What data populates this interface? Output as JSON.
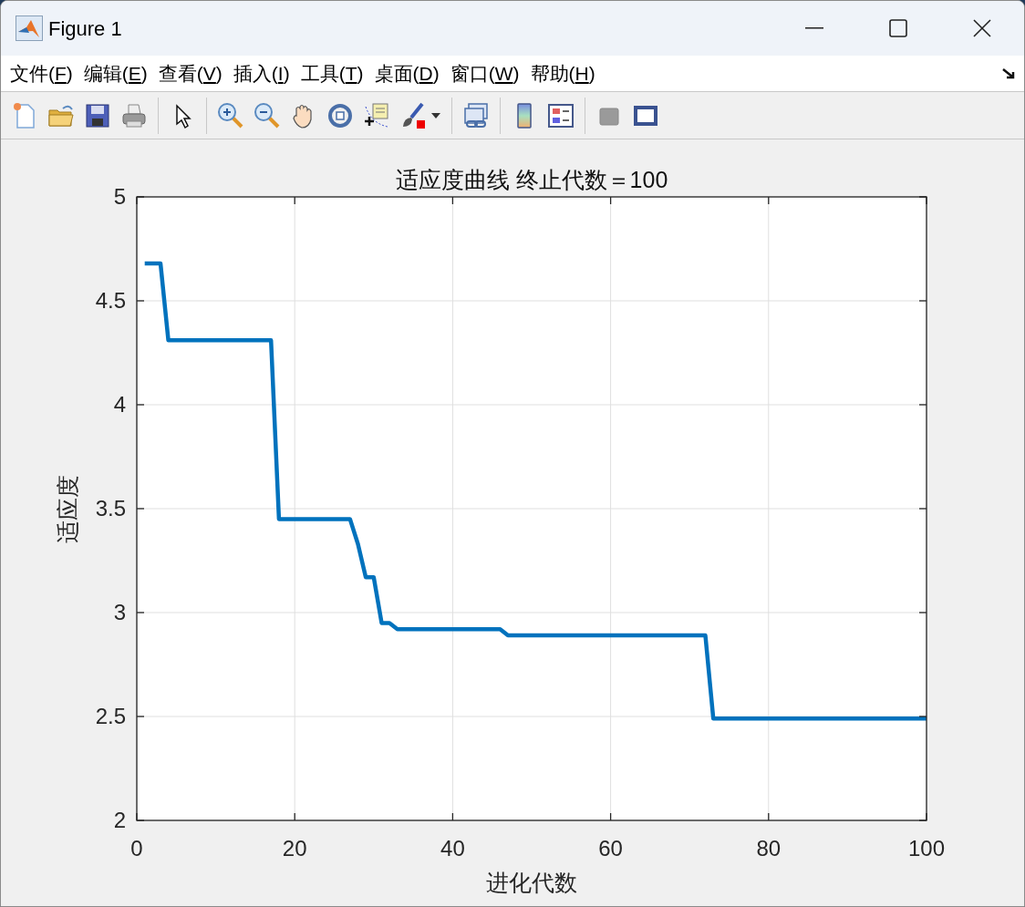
{
  "window": {
    "title": "Figure 1"
  },
  "menu": [
    {
      "label": "文件(F)"
    },
    {
      "label": "编辑(E)"
    },
    {
      "label": "查看(V)"
    },
    {
      "label": "插入(I)"
    },
    {
      "label": "工具(T)"
    },
    {
      "label": "桌面(D)"
    },
    {
      "label": "窗口(W)"
    },
    {
      "label": "帮助(H)"
    }
  ],
  "figure": {
    "chart_data": {
      "type": "line",
      "title": "适应度曲线 终止代数＝100",
      "xlabel": "进化代数",
      "ylabel": "适应度",
      "x": [
        1,
        2,
        3,
        4,
        5,
        6,
        7,
        8,
        9,
        10,
        11,
        12,
        13,
        14,
        15,
        16,
        17,
        18,
        19,
        20,
        21,
        22,
        23,
        24,
        25,
        26,
        27,
        28,
        29,
        30,
        31,
        32,
        33,
        34,
        35,
        36,
        37,
        38,
        39,
        40,
        41,
        42,
        43,
        44,
        45,
        46,
        47,
        48,
        49,
        50,
        51,
        52,
        53,
        54,
        55,
        56,
        57,
        58,
        59,
        60,
        61,
        62,
        63,
        64,
        65,
        66,
        67,
        68,
        69,
        70,
        71,
        72,
        73,
        74,
        75,
        76,
        77,
        78,
        79,
        80,
        81,
        82,
        83,
        84,
        85,
        86,
        87,
        88,
        89,
        90,
        91,
        92,
        93,
        94,
        95,
        96,
        97,
        98,
        99,
        100
      ],
      "series": [
        {
          "color": "#0072bd",
          "values": [
            4.68,
            4.68,
            4.68,
            4.31,
            4.31,
            4.31,
            4.31,
            4.31,
            4.31,
            4.31,
            4.31,
            4.31,
            4.31,
            4.31,
            4.31,
            4.31,
            4.31,
            3.45,
            3.45,
            3.45,
            3.45,
            3.45,
            3.45,
            3.45,
            3.45,
            3.45,
            3.45,
            3.33,
            3.17,
            3.17,
            2.95,
            2.95,
            2.92,
            2.92,
            2.92,
            2.92,
            2.92,
            2.92,
            2.92,
            2.92,
            2.92,
            2.92,
            2.92,
            2.92,
            2.92,
            2.92,
            2.89,
            2.89,
            2.89,
            2.89,
            2.89,
            2.89,
            2.89,
            2.89,
            2.89,
            2.89,
            2.89,
            2.89,
            2.89,
            2.89,
            2.89,
            2.89,
            2.89,
            2.89,
            2.89,
            2.89,
            2.89,
            2.89,
            2.89,
            2.89,
            2.89,
            2.89,
            2.49,
            2.49,
            2.49,
            2.49,
            2.49,
            2.49,
            2.49,
            2.49,
            2.49,
            2.49,
            2.49,
            2.49,
            2.49,
            2.49,
            2.49,
            2.49,
            2.49,
            2.49,
            2.49,
            2.49,
            2.49,
            2.49,
            2.49,
            2.49,
            2.49,
            2.49,
            2.49,
            2.49
          ]
        }
      ],
      "xlim": [
        0,
        100
      ],
      "ylim": [
        2,
        5
      ],
      "grid": true,
      "xticks": [
        0,
        20,
        40,
        60,
        80,
        100
      ],
      "yticks": [
        2,
        2.5,
        3,
        3.5,
        4,
        4.5,
        5
      ]
    }
  }
}
